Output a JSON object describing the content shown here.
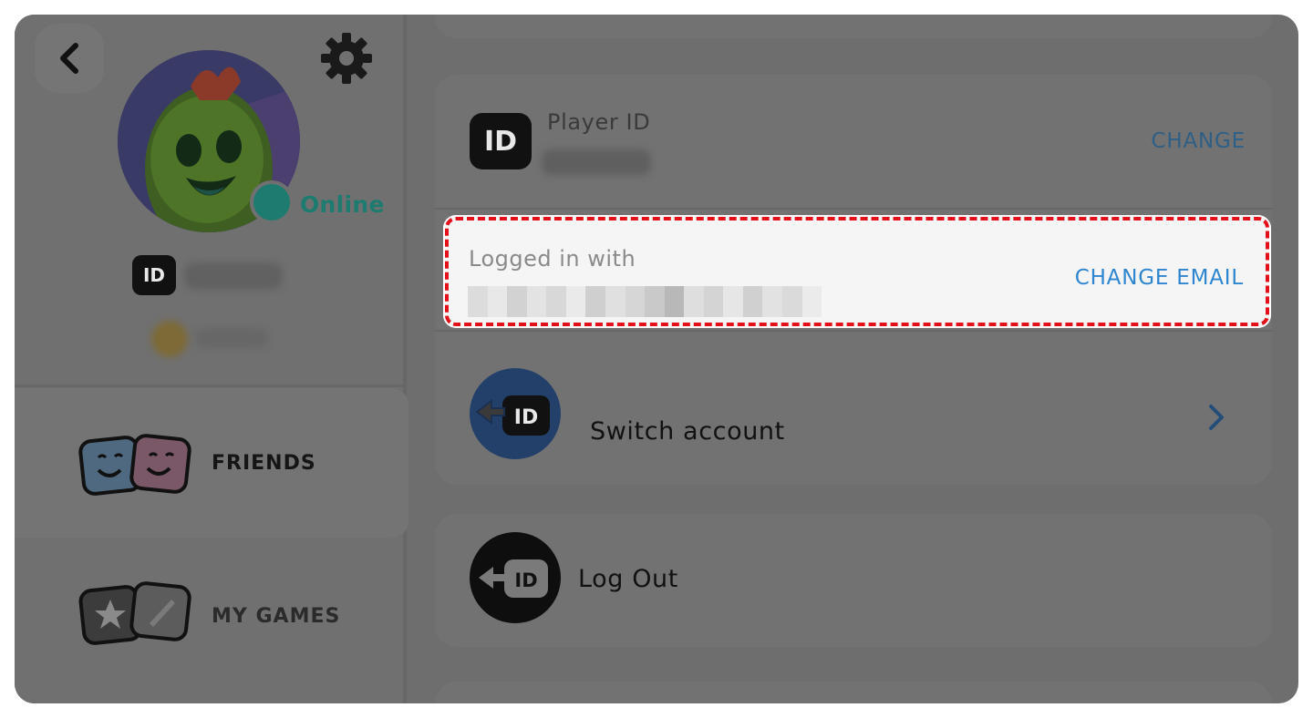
{
  "left_panel": {
    "status": "Online",
    "id_badge": "ID",
    "nav": [
      {
        "label": "FRIENDS"
      },
      {
        "label": "MY GAMES"
      }
    ]
  },
  "account": {
    "player_id": {
      "badge": "ID",
      "label": "Player ID",
      "action": "CHANGE"
    },
    "login": {
      "label": "Logged in with",
      "action": "CHANGE EMAIL"
    },
    "switch": {
      "badge": "ID",
      "label": "Switch account"
    },
    "logout": {
      "badge": "ID",
      "label": "Log Out"
    }
  },
  "colors": {
    "highlight_border": "#e3101a",
    "link_blue": "#2d86cf",
    "online_green": "#1d7b70"
  }
}
